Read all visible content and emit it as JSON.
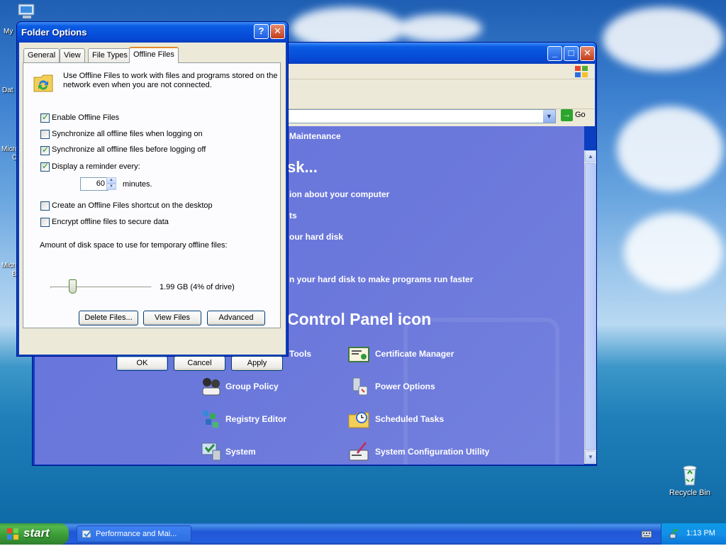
{
  "desktop": {
    "icons": {
      "my": "My",
      "dat": "Dat",
      "micro1": "Micro",
      "c": "C",
      "micro2": "Micro",
      "b": "B",
      "recycle_bin": "Recycle Bin"
    }
  },
  "control_panel": {
    "address_go": "Go",
    "breadcrumb": "Maintenance",
    "heading_task": "sk...",
    "heading_icon": "Control Panel icon",
    "tasks": [
      "ion about your computer",
      "ts",
      "our hard disk",
      "n your hard disk to make programs run faster"
    ],
    "icons": [
      "Tools",
      "Certificate Manager",
      "Group Policy",
      "Power Options",
      "Registry Editor",
      "Scheduled Tasks",
      "System",
      "System Configuration Utility"
    ]
  },
  "dialog": {
    "title": "Folder Options",
    "tabs": [
      "General",
      "View",
      "File Types",
      "Offline Files"
    ],
    "description": [
      "Use Offline Files to work with files and programs stored on the",
      "network even when you are not connected."
    ],
    "checkboxes": {
      "enable": "Enable Offline Files",
      "sync_logon": "Synchronize all offline files when logging on",
      "sync_logoff": "Synchronize all offline files before logging off",
      "reminder": "Display a reminder every:",
      "shortcut": "Create an Offline Files shortcut on the desktop",
      "encrypt": "Encrypt offline files to secure data"
    },
    "reminder_minutes": "60",
    "minutes_label": "minutes.",
    "disk_space_label": "Amount of disk space to use for temporary offline files:",
    "disk_space_value": "1.99 GB (4% of drive)",
    "buttons": {
      "delete_files": "Delete Files...",
      "view_files": "View Files",
      "advanced": "Advanced",
      "ok": "OK",
      "cancel": "Cancel",
      "apply": "Apply"
    }
  },
  "taskbar": {
    "start": "start",
    "task_item": "Performance and Mai...",
    "clock": "1:13 PM"
  },
  "colors": {
    "title_blue": "#0a5ce3",
    "cp_panel": "#6b78db",
    "start_green": "#3b9d38",
    "dialog_face": "#ece9d8"
  }
}
